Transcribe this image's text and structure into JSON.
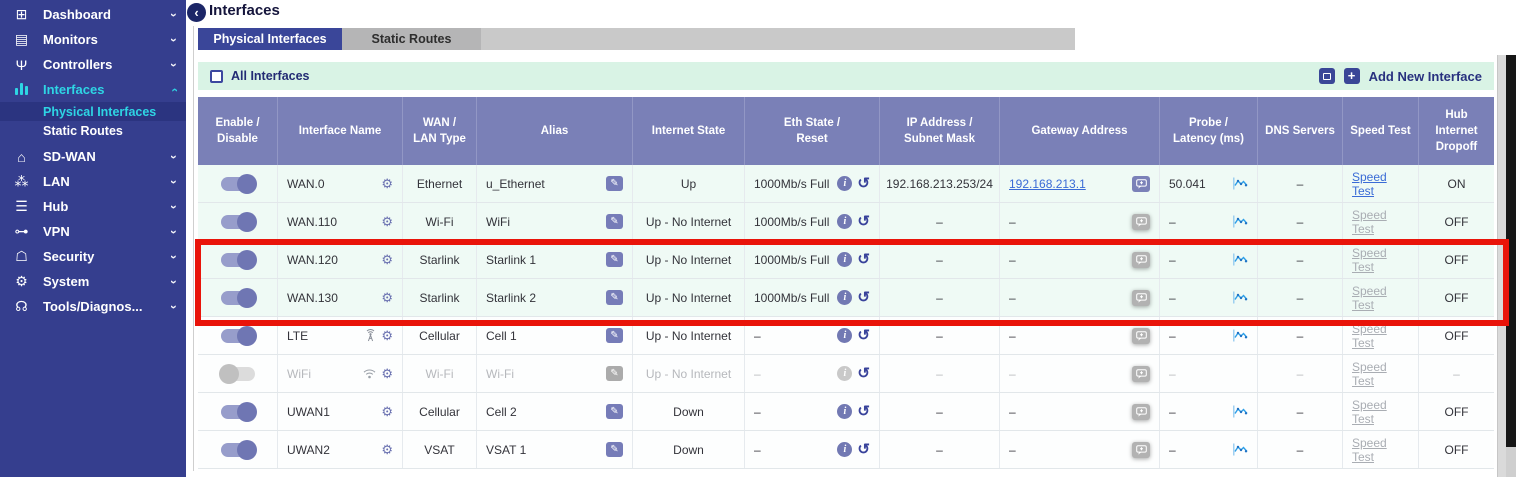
{
  "header": {
    "title": "Interfaces",
    "collapse_icon": "chevron-left-icon"
  },
  "sidebar": {
    "items": [
      {
        "icon": "dashboard-icon",
        "label": "Dashboard",
        "chevron": "down"
      },
      {
        "icon": "monitors-icon",
        "label": "Monitors",
        "chevron": "down"
      },
      {
        "icon": "controllers-icon",
        "label": "Controllers",
        "chevron": "down"
      },
      {
        "icon": "interfaces-icon",
        "label": "Interfaces",
        "chevron": "up",
        "active": true,
        "children": [
          {
            "label": "Physical Interfaces",
            "selected": true
          },
          {
            "label": "Static Routes",
            "selected": false
          }
        ]
      },
      {
        "icon": "sdwan-router-icon",
        "label": "SD-WAN",
        "chevron": "down"
      },
      {
        "icon": "lan-icon",
        "label": "LAN",
        "chevron": "down"
      },
      {
        "icon": "hub-sliders-icon",
        "label": "Hub",
        "chevron": "down"
      },
      {
        "icon": "vpn-key-icon",
        "label": "VPN",
        "chevron": "down"
      },
      {
        "icon": "security-shield-icon",
        "label": "Security",
        "chevron": "down"
      },
      {
        "icon": "system-user-gear-icon",
        "label": "System",
        "chevron": "down"
      },
      {
        "icon": "tools-headset-icon",
        "label": "Tools/Diagnos...",
        "chevron": "down"
      }
    ]
  },
  "tabs": [
    {
      "label": "Physical Interfaces",
      "active": true
    },
    {
      "label": "Static Routes",
      "active": false
    }
  ],
  "toolbar": {
    "all_interfaces_label": "All Interfaces",
    "all_interfaces_checked": false,
    "bulk_icon": "window-icon",
    "add_icon": "plus-icon",
    "add_new_label": "Add New Interface"
  },
  "table": {
    "columns": [
      "Enable /\nDisable",
      "Interface Name",
      "WAN /\nLAN Type",
      "Alias",
      "Internet State",
      "Eth State /\nReset",
      "IP Address /\nSubnet Mask",
      "Gateway Address",
      "Probe /\nLatency (ms)",
      "DNS Servers",
      "Speed Test",
      "Hub\nInternet\nDropoff"
    ],
    "rows": [
      {
        "enabled": true,
        "dimmed": false,
        "tinted": true,
        "name": "WAN.0",
        "name_icons": [
          "gear-icon"
        ],
        "type": "Ethernet",
        "alias": "u_Ethernet",
        "internet_state": "Up",
        "eth_state": "1000Mb/s Full",
        "ip": "192.168.213.253/24",
        "gateway": "192.168.213.1",
        "gateway_is_link": true,
        "gateway_btn_enabled": true,
        "probe": "50.041",
        "probe_chart": true,
        "dns": "–",
        "speed_test": "Speed Test",
        "speed_test_enabled": true,
        "hub": "ON"
      },
      {
        "enabled": true,
        "dimmed": false,
        "tinted": true,
        "name": "WAN.110",
        "name_icons": [
          "gear-icon"
        ],
        "type": "Wi-Fi",
        "alias": "WiFi",
        "internet_state": "Up - No Internet",
        "eth_state": "1000Mb/s Full",
        "ip": "–",
        "gateway": "–",
        "gateway_is_link": false,
        "gateway_btn_enabled": false,
        "probe": "–",
        "probe_chart": true,
        "dns": "–",
        "speed_test": "Speed Test",
        "speed_test_enabled": false,
        "hub": "OFF"
      },
      {
        "enabled": true,
        "dimmed": false,
        "tinted": true,
        "name": "WAN.120",
        "name_icons": [
          "gear-icon"
        ],
        "type": "Starlink",
        "alias": "Starlink 1",
        "internet_state": "Up - No Internet",
        "eth_state": "1000Mb/s Full",
        "ip": "–",
        "gateway": "–",
        "gateway_is_link": false,
        "gateway_btn_enabled": false,
        "probe": "–",
        "probe_chart": true,
        "dns": "–",
        "speed_test": "Speed Test",
        "speed_test_enabled": false,
        "hub": "OFF",
        "highlighted": true
      },
      {
        "enabled": true,
        "dimmed": false,
        "tinted": true,
        "name": "WAN.130",
        "name_icons": [
          "gear-icon"
        ],
        "type": "Starlink",
        "alias": "Starlink 2",
        "internet_state": "Up - No Internet",
        "eth_state": "1000Mb/s Full",
        "ip": "–",
        "gateway": "–",
        "gateway_is_link": false,
        "gateway_btn_enabled": false,
        "probe": "–",
        "probe_chart": true,
        "dns": "–",
        "speed_test": "Speed Test",
        "speed_test_enabled": false,
        "hub": "OFF",
        "highlighted": true
      },
      {
        "enabled": true,
        "dimmed": false,
        "tinted": false,
        "name": "LTE",
        "name_icons": [
          "cell-tower-icon",
          "gear-icon"
        ],
        "type": "Cellular",
        "alias": "Cell 1",
        "internet_state": "Up - No Internet",
        "eth_state": "–",
        "ip": "–",
        "gateway": "–",
        "gateway_is_link": false,
        "gateway_btn_enabled": false,
        "probe": "–",
        "probe_chart": true,
        "dns": "–",
        "speed_test": "Speed Test",
        "speed_test_enabled": false,
        "hub": "OFF"
      },
      {
        "enabled": false,
        "dimmed": true,
        "tinted": false,
        "name": "WiFi",
        "name_icons": [
          "wifi-icon",
          "gear-icon"
        ],
        "type": "Wi-Fi",
        "alias": "Wi-Fi",
        "internet_state": "Up - No Internet",
        "eth_state": "–",
        "ip": "–",
        "gateway": "–",
        "gateway_is_link": false,
        "gateway_btn_enabled": false,
        "probe": "–",
        "probe_chart": false,
        "dns": "–",
        "speed_test": "Speed Test",
        "speed_test_enabled": false,
        "hub": "–",
        "eth_info_dimmed": true
      },
      {
        "enabled": true,
        "dimmed": false,
        "tinted": false,
        "name": "UWAN1",
        "name_icons": [
          "gear-icon"
        ],
        "type": "Cellular",
        "alias": "Cell 2",
        "internet_state": "Down",
        "eth_state": "–",
        "ip": "–",
        "gateway": "–",
        "gateway_is_link": false,
        "gateway_btn_enabled": false,
        "probe": "–",
        "probe_chart": true,
        "dns": "–",
        "speed_test": "Speed Test",
        "speed_test_enabled": false,
        "hub": "OFF"
      },
      {
        "enabled": true,
        "dimmed": false,
        "tinted": false,
        "name": "UWAN2",
        "name_icons": [
          "gear-icon"
        ],
        "type": "VSAT",
        "alias": "VSAT 1",
        "internet_state": "Down",
        "eth_state": "–",
        "ip": "–",
        "gateway": "–",
        "gateway_is_link": false,
        "gateway_btn_enabled": false,
        "probe": "–",
        "probe_chart": true,
        "dns": "–",
        "speed_test": "Speed Test",
        "speed_test_enabled": false,
        "hub": "OFF"
      }
    ]
  },
  "annotation": {
    "type": "highlight-box",
    "color": "#e9140a",
    "around_rows": [
      "WAN.120",
      "WAN.130"
    ]
  },
  "colors": {
    "sidebar_bg": "#353e8e",
    "sidebar_active": "#2ed5e4",
    "tab_active_bg": "#3a4699",
    "toolbar_band_bg": "#d9f3e5",
    "table_header_bg": "#7a80b7",
    "row_tint_bg": "#effaf5",
    "link_blue": "#3a6bd6",
    "accent_indigo": "#3a4697",
    "highlight_red": "#e9140a"
  }
}
